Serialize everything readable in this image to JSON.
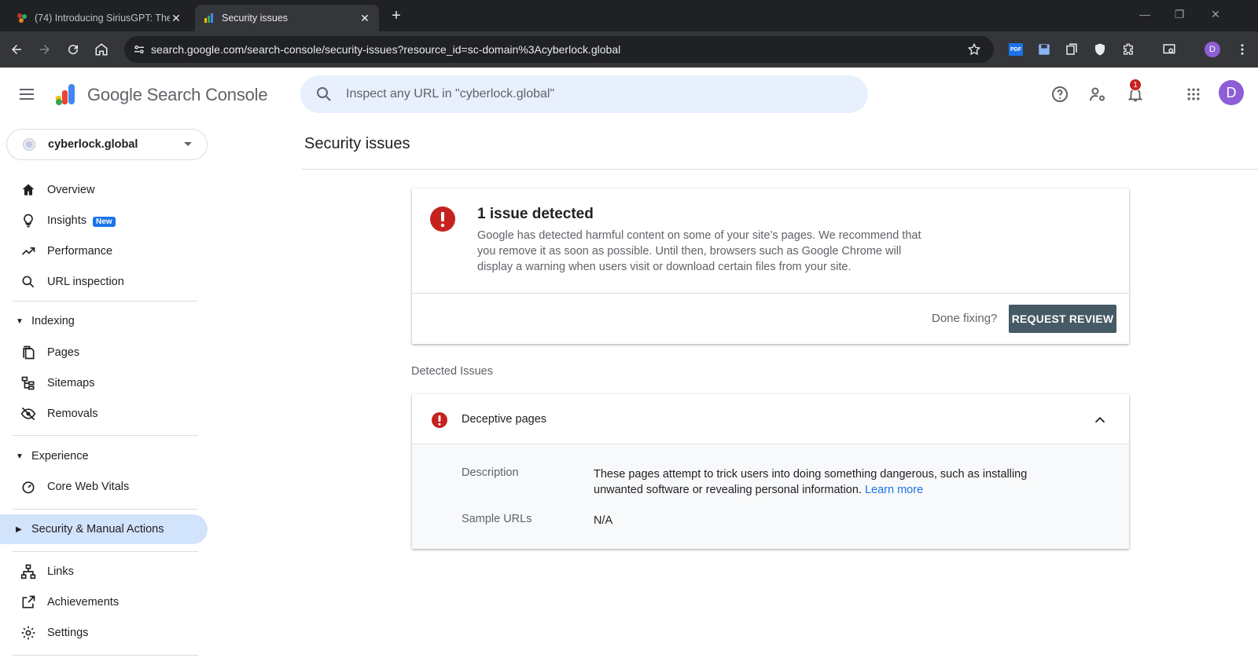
{
  "browser": {
    "tabs": [
      {
        "title": "(74) Introducing SiriusGPT: The",
        "active": false
      },
      {
        "title": "Security issues",
        "active": true
      }
    ],
    "url": "search.google.com/search-console/security-issues?resource_id=sc-domain%3Acyberlock.global",
    "profile_initial": "D"
  },
  "header": {
    "brand": "Google Search Console",
    "search_placeholder": "Inspect any URL in \"cyberlock.global\"",
    "notification_count": "1",
    "avatar_initial": "D"
  },
  "sidebar": {
    "property": "cyberlock.global",
    "items": [
      {
        "label": "Overview",
        "icon": "home-icon"
      },
      {
        "label": "Insights",
        "icon": "lightbulb-icon",
        "badge": "New"
      },
      {
        "label": "Performance",
        "icon": "trending-up-icon"
      },
      {
        "label": "URL inspection",
        "icon": "search-icon"
      }
    ],
    "indexing": {
      "label": "Indexing",
      "items": [
        {
          "label": "Pages",
          "icon": "pages-icon"
        },
        {
          "label": "Sitemaps",
          "icon": "sitemap-icon"
        },
        {
          "label": "Removals",
          "icon": "eye-off-icon"
        }
      ]
    },
    "experience": {
      "label": "Experience",
      "items": [
        {
          "label": "Core Web Vitals",
          "icon": "speedometer-icon"
        }
      ]
    },
    "security": {
      "label": "Security & Manual Actions",
      "active": true
    },
    "bottom": [
      {
        "label": "Links",
        "icon": "links-icon"
      },
      {
        "label": "Achievements",
        "icon": "achievements-icon"
      },
      {
        "label": "Settings",
        "icon": "gear-icon"
      }
    ]
  },
  "main": {
    "title": "Security issues",
    "summary": {
      "title": "1 issue detected",
      "description": "Google has detected harmful content on some of your site’s pages. We recommend that you remove it as soon as possible. Until then, browsers such as Google Chrome will display a warning when users visit or download certain files from your site.",
      "done_label": "Done fixing?",
      "button_label": "REQUEST REVIEW"
    },
    "detected_label": "Detected Issues",
    "issue": {
      "name": "Deceptive pages",
      "description_label": "Description",
      "description": "These pages attempt to trick users into doing something dangerous, such as installing unwanted software or revealing personal information.",
      "learn_more": "Learn more",
      "sample_label": "Sample URLs",
      "sample_value": "N/A"
    }
  },
  "colors": {
    "accent": "#1a73e8",
    "error": "#c5221f",
    "button": "#455a64",
    "active_nav": "#d2e3fc"
  }
}
